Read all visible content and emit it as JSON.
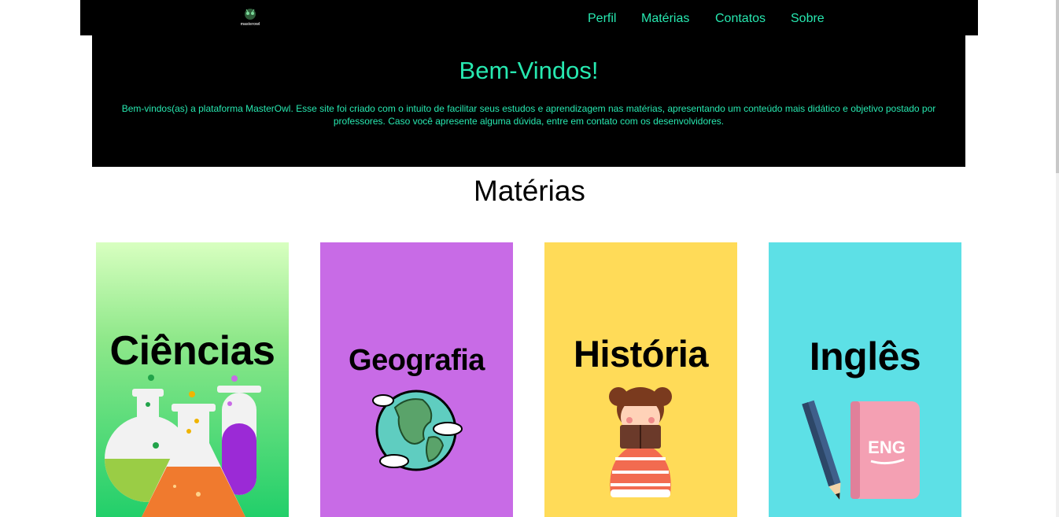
{
  "nav": {
    "logo_text": "masterowl",
    "links": [
      "Perfil",
      "Matérias",
      "Contatos",
      "Sobre"
    ]
  },
  "hero": {
    "title": "Bem-Vindos!",
    "text": "Bem-vindos(as) a plataforma MasterOwl. Esse site foi criado com o intuito de facilitar seus estudos e aprendizagem nas matérias, apresentando um conteúdo mais didático e objetivo postado por professores. Caso você apresente alguma dúvida, entre em contato com os desenvolvidores."
  },
  "section": {
    "title": "Matérias"
  },
  "cards": [
    {
      "title": "Ciências",
      "icon": "lab-flasks-icon",
      "bg": "#37d67a"
    },
    {
      "title": "Geografia",
      "icon": "globe-icon",
      "bg": "#c86be6"
    },
    {
      "title": "História",
      "icon": "girl-reading-icon",
      "bg": "#ffdb58"
    },
    {
      "title": "Inglês",
      "icon": "book-pencil-icon",
      "bg": "#5de0e6"
    },
    {
      "eng_label": "ENG"
    }
  ],
  "colors": {
    "accent": "#27e8b0",
    "nav_bg": "#000000"
  }
}
